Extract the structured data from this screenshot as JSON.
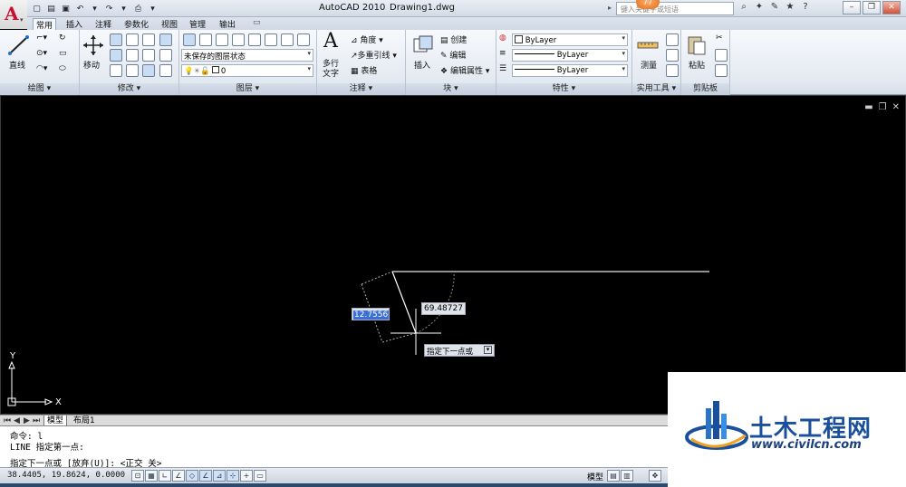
{
  "titlebar": {
    "app_title": "AutoCAD 2010",
    "doc_title": "Drawing1.dwg",
    "search_placeholder": "键入关键字或短语",
    "notification_count": "77"
  },
  "ribbon_tabs": [
    "常用",
    "插入",
    "注释",
    "参数化",
    "视图",
    "管理",
    "输出"
  ],
  "ribbon": {
    "draw": {
      "line_label": "直线",
      "panel_label": "绘图 ▾"
    },
    "modify": {
      "move_label": "移动",
      "panel_label": "修改 ▾"
    },
    "layers": {
      "state_combo": "未保存的图层状态",
      "layer_combo": "0",
      "panel_label": "图层 ▾"
    },
    "annotation": {
      "mtext_label": "多行\n文字",
      "angle": "角度",
      "mleader": "多重引线",
      "table": "表格",
      "panel_label": "注释 ▾"
    },
    "block": {
      "insert": "插入",
      "create": "创建",
      "edit": "编辑",
      "edit_attr": "编辑属性",
      "panel_label": "块 ▾"
    },
    "properties": {
      "color": "ByLayer",
      "linetype": "ByLayer",
      "lineweight": "ByLayer",
      "panel_label": "特性 ▾"
    },
    "utilities": {
      "measure": "测量",
      "panel_label": "实用工具 ▾"
    },
    "clipboard": {
      "paste": "粘贴",
      "panel_label": "剪贴板"
    }
  },
  "canvas": {
    "dynamic_input_length": "12.7556",
    "dynamic_input_angle": "69.48727",
    "prompt_tooltip": "指定下一点或",
    "ucs_x": "X",
    "ucs_y": "Y"
  },
  "layout_tabs": [
    "模型",
    "布局1"
  ],
  "command_line": {
    "line1": "命令: l",
    "line2": "LINE 指定第一点:",
    "line3": "指定下一点或 [放弃(U)]:  <正交 关>"
  },
  "statusbar": {
    "coords": "38.4405, 19.8624, 0.0000",
    "model_label": "模型"
  },
  "watermark": {
    "title": "土木工程网",
    "url": "www.civilcn.com"
  },
  "colors": {
    "canvas_bg": "#000000",
    "accent_red": "#c8102e",
    "dyn_input_bg": "#3b6fd8",
    "watermark_blue": "#1a4f9c"
  }
}
